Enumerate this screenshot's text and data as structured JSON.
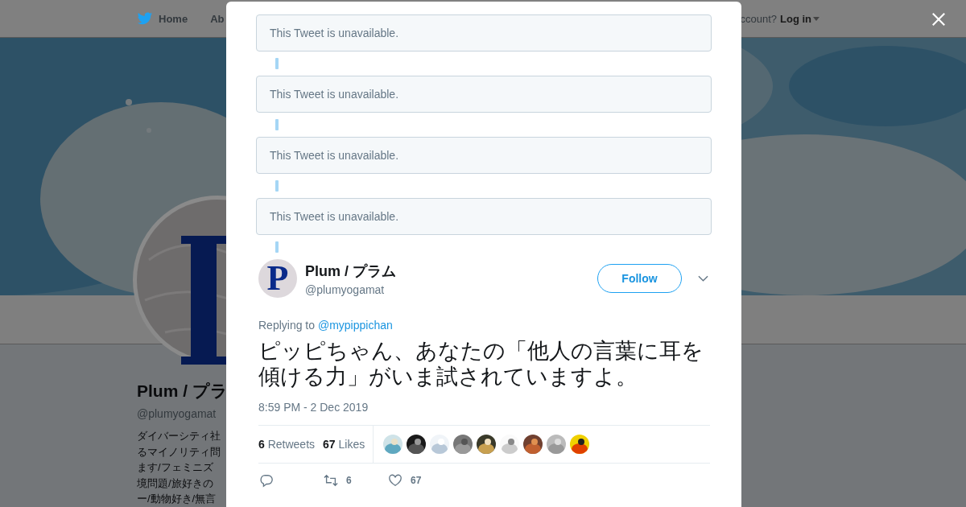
{
  "top_nav": {
    "items": [
      {
        "label": "Home",
        "kind": "home"
      },
      {
        "label": "Ab",
        "kind": "plain"
      }
    ],
    "account_prompt": "ccount?",
    "login": "Log in"
  },
  "profile": {
    "name": "Plum / プラ",
    "handle": "@plumyogamat",
    "bio_lines": [
      "ダイバーシティ社",
      "るマイノリティ問",
      "ます/フェミニズ",
      "境問題/旅好きの",
      "ー/動物好き/無言"
    ]
  },
  "thread": {
    "unavailable": [
      "This Tweet is unavailable.",
      "This Tweet is unavailable.",
      "This Tweet is unavailable.",
      "This Tweet is unavailable."
    ]
  },
  "tweet": {
    "avatar_letter": "P",
    "name": "Plum / プラム",
    "handle": "@plumyogamat",
    "follow": "Follow",
    "replying_to": "Replying to",
    "reply_handle": "@mypippichan",
    "text": "ピッピちゃん、あなたの「他人の言葉に耳を傾ける力」がいま試されていますよ。",
    "time": "8:59 PM - 2 Dec 2019",
    "stats": [
      {
        "count": "6",
        "label": "Retweets"
      },
      {
        "count": "67",
        "label": "Likes"
      }
    ],
    "actions": [
      {
        "kind": "reply"
      },
      {
        "kind": "retweet",
        "count": "6"
      },
      {
        "kind": "like",
        "count": "67"
      }
    ]
  }
}
